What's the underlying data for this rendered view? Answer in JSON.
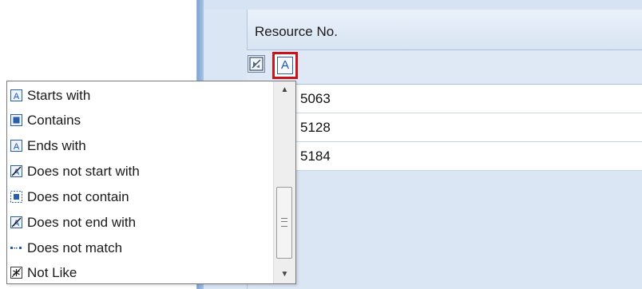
{
  "grid": {
    "column_header": "Resource No.",
    "rows": [
      {
        "resource_no": "5063"
      },
      {
        "resource_no": "5128"
      },
      {
        "resource_no": "5184"
      }
    ],
    "filter": {
      "clear_icon": "filter-clear-icon",
      "operator_icon": "starts-with-icon",
      "operator_letter": "A"
    }
  },
  "dropdown": {
    "options": [
      {
        "label": "Starts with",
        "icon": "starts-with-icon"
      },
      {
        "label": "Contains",
        "icon": "contains-icon"
      },
      {
        "label": "Ends with",
        "icon": "ends-with-icon"
      },
      {
        "label": "Does not start with",
        "icon": "does-not-start-with-icon"
      },
      {
        "label": "Does not contain",
        "icon": "does-not-contain-icon"
      },
      {
        "label": "Does not end with",
        "icon": "does-not-end-with-icon"
      },
      {
        "label": "Does not match",
        "icon": "does-not-match-icon"
      },
      {
        "label": "Not Like",
        "icon": "not-like-icon"
      }
    ]
  },
  "colors": {
    "highlight_border": "#c8151c",
    "icon_blue": "#2b5ea8",
    "grid_background": "#dbe6f4"
  }
}
